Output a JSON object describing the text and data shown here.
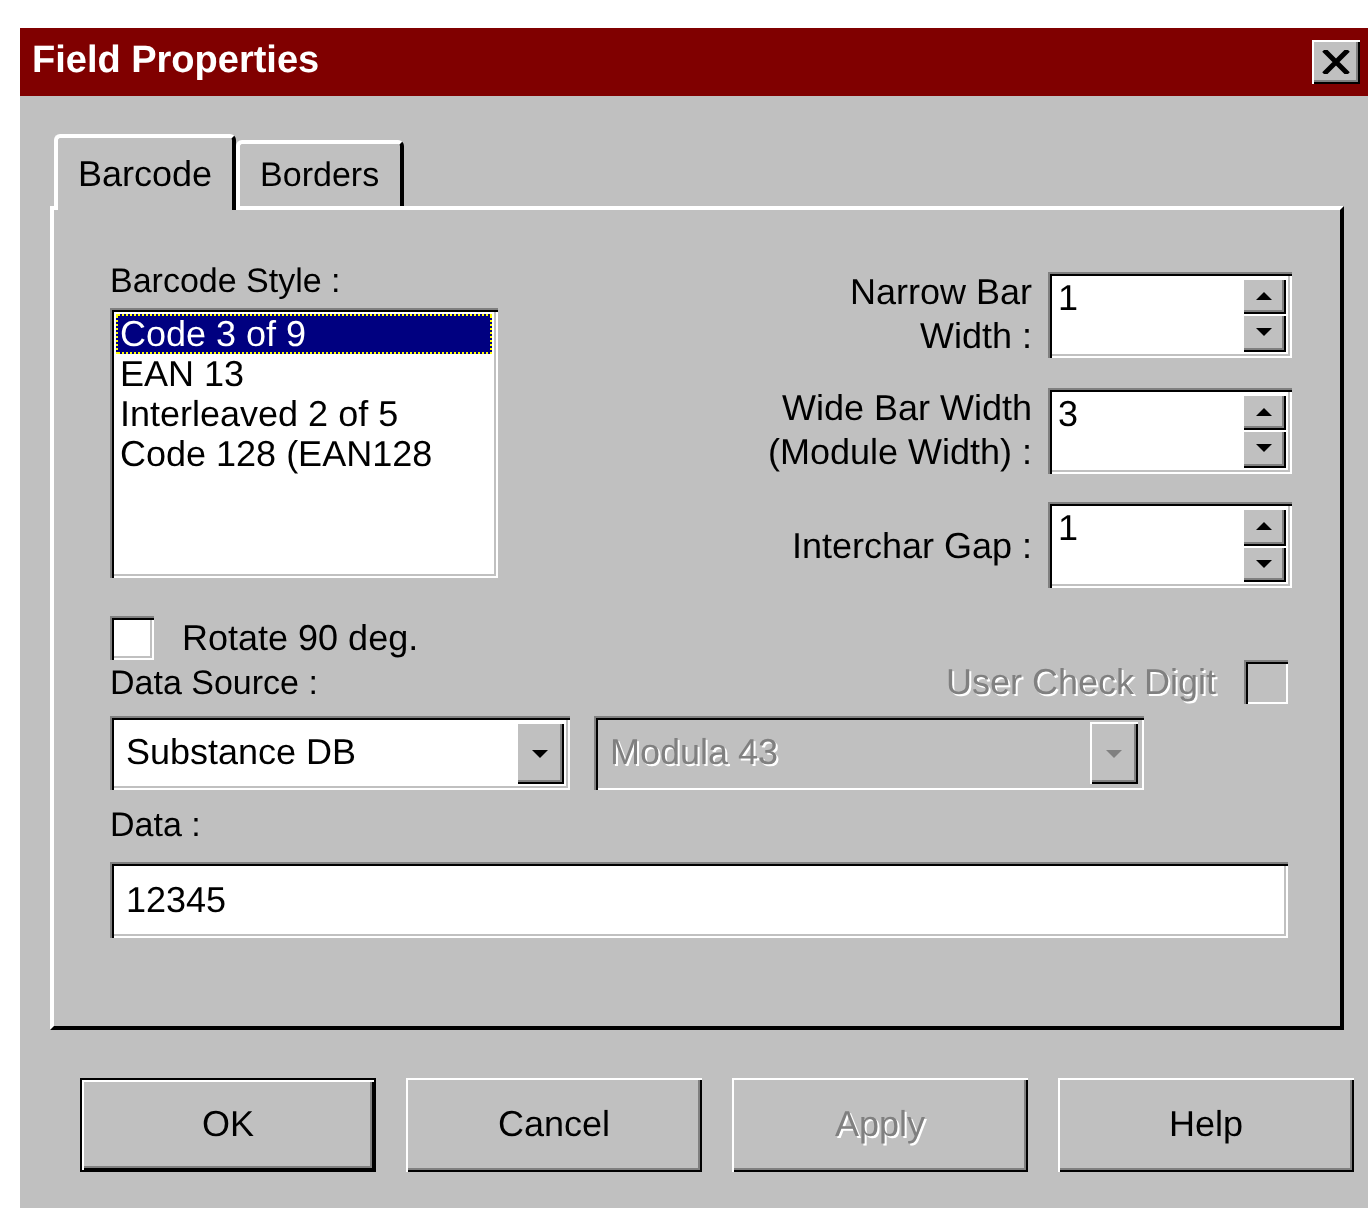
{
  "window": {
    "title": "Field Properties"
  },
  "tabs": [
    {
      "label": "Barcode",
      "selected": true
    },
    {
      "label": "Borders",
      "selected": false
    }
  ],
  "barcode_style": {
    "label": "Barcode Style :",
    "items": [
      {
        "label": "Code 3 of 9",
        "selected": true
      },
      {
        "label": "EAN 13",
        "selected": false
      },
      {
        "label": "Interleaved 2 of 5",
        "selected": false
      },
      {
        "label": "Code 128 (EAN128",
        "selected": false
      }
    ]
  },
  "spinners": [
    {
      "label": "Narrow Bar\nWidth :",
      "value": "1"
    },
    {
      "label": "Wide Bar Width\n(Module Width) :",
      "value": "3"
    },
    {
      "label": "Interchar Gap :",
      "value": "1"
    }
  ],
  "rotate": {
    "label": "Rotate 90 deg.",
    "checked": false
  },
  "user_check_digit": {
    "label": "User Check Digit",
    "checked": false,
    "disabled": true
  },
  "data_source": {
    "label": "Data Source :",
    "value": "Substance DB",
    "disabled": false
  },
  "check_method": {
    "value": "Modula 43",
    "disabled": true
  },
  "data": {
    "label": "Data :",
    "value": "12345"
  },
  "buttons": [
    {
      "label": "OK",
      "default": true,
      "disabled": false
    },
    {
      "label": "Cancel",
      "default": false,
      "disabled": false
    },
    {
      "label": "Apply",
      "default": false,
      "disabled": true
    },
    {
      "label": "Help",
      "default": false,
      "disabled": false
    }
  ]
}
